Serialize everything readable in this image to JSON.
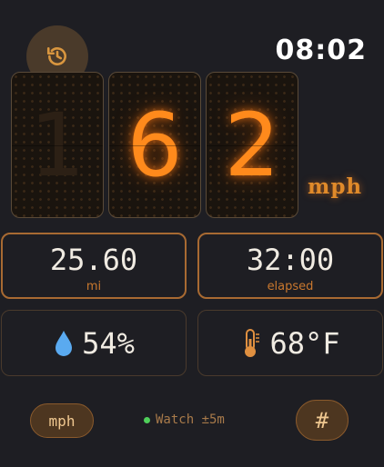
{
  "header": {
    "history_icon": "history-icon",
    "clock": "08:02"
  },
  "speed": {
    "digits": [
      "1",
      "6",
      "2"
    ],
    "lit": [
      false,
      true,
      true
    ],
    "unit": "mph"
  },
  "stats": {
    "distance": {
      "value": "25.60",
      "label": "mi"
    },
    "elapsed": {
      "value": "32:00",
      "label": "elapsed"
    },
    "humidity": {
      "value": "54%",
      "icon": "water-drop-icon"
    },
    "temperature": {
      "value": "68°F",
      "icon": "thermometer-icon"
    }
  },
  "footer": {
    "unit_toggle": "mph",
    "watch_status": "Watch ±5m",
    "watch_status_color": "#4fcf5a",
    "number_button": "#"
  },
  "colors": {
    "accent": "#ff8a1c",
    "background": "#1e1e23"
  }
}
